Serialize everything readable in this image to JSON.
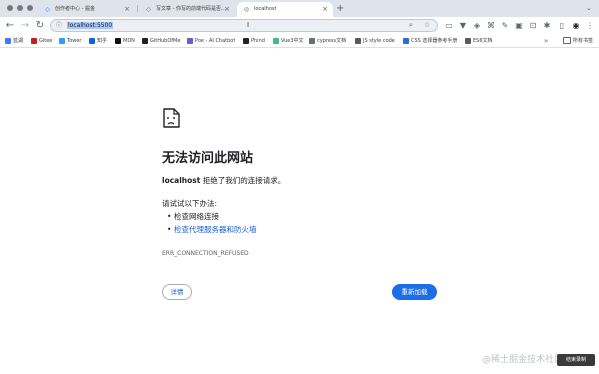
{
  "tabs": [
    {
      "title": "创作者中心 - 掘金",
      "favicon": "juejin-icon",
      "active": false
    },
    {
      "title": "写文章 - 你写的前端代码是否符合规范",
      "favicon": "juejin-icon",
      "active": false
    },
    {
      "title": "localhost",
      "favicon": "globe-icon",
      "active": true
    }
  ],
  "toolbar": {
    "url": "localhost:5500",
    "cursor_glyph": "I"
  },
  "bookmarks": [
    {
      "label": "蓝湖",
      "color": "#3b7bf6"
    },
    {
      "label": "Gitee",
      "color": "#c71d23"
    },
    {
      "label": "Tower",
      "color": "#2f9cf5"
    },
    {
      "label": "知乎",
      "color": "#0a66d8"
    },
    {
      "label": "MDN",
      "color": "#111111"
    },
    {
      "label": "GitHubOfMe",
      "color": "#222222"
    },
    {
      "label": "Poe - AI Chatbot",
      "color": "#6b5bd2"
    },
    {
      "label": "Phind",
      "color": "#222222"
    },
    {
      "label": "Vue3中文",
      "color": "#42b883"
    },
    {
      "label": "cypress文档",
      "color": "#69707a"
    },
    {
      "label": "JS style code",
      "color": "#5a5a5a"
    },
    {
      "label": "CSS 选择器参考手册",
      "color": "#2a6bd6"
    },
    {
      "label": "ES6文档",
      "color": "#5a5a5a"
    }
  ],
  "bookmarks_all": "所有书签",
  "error": {
    "title": "无法访问此网站",
    "host": "localhost",
    "description": " 拒绝了我们的连接请求。",
    "try_label": "请试试以下办法:",
    "suggestions": [
      "检查网络连接",
      "检查代理服务器和防火墙"
    ],
    "code": "ERR_CONNECTION_REFUSED",
    "details_button": "详情",
    "reload_button": "重新加载"
  },
  "overlay": {
    "watermark": "@稀土掘金技术社区",
    "recorder_label": "结束录制"
  },
  "colors": {
    "accent": "#1b6ee6",
    "link": "#1a5fd0",
    "tabstrip": "#dfe3eb"
  }
}
